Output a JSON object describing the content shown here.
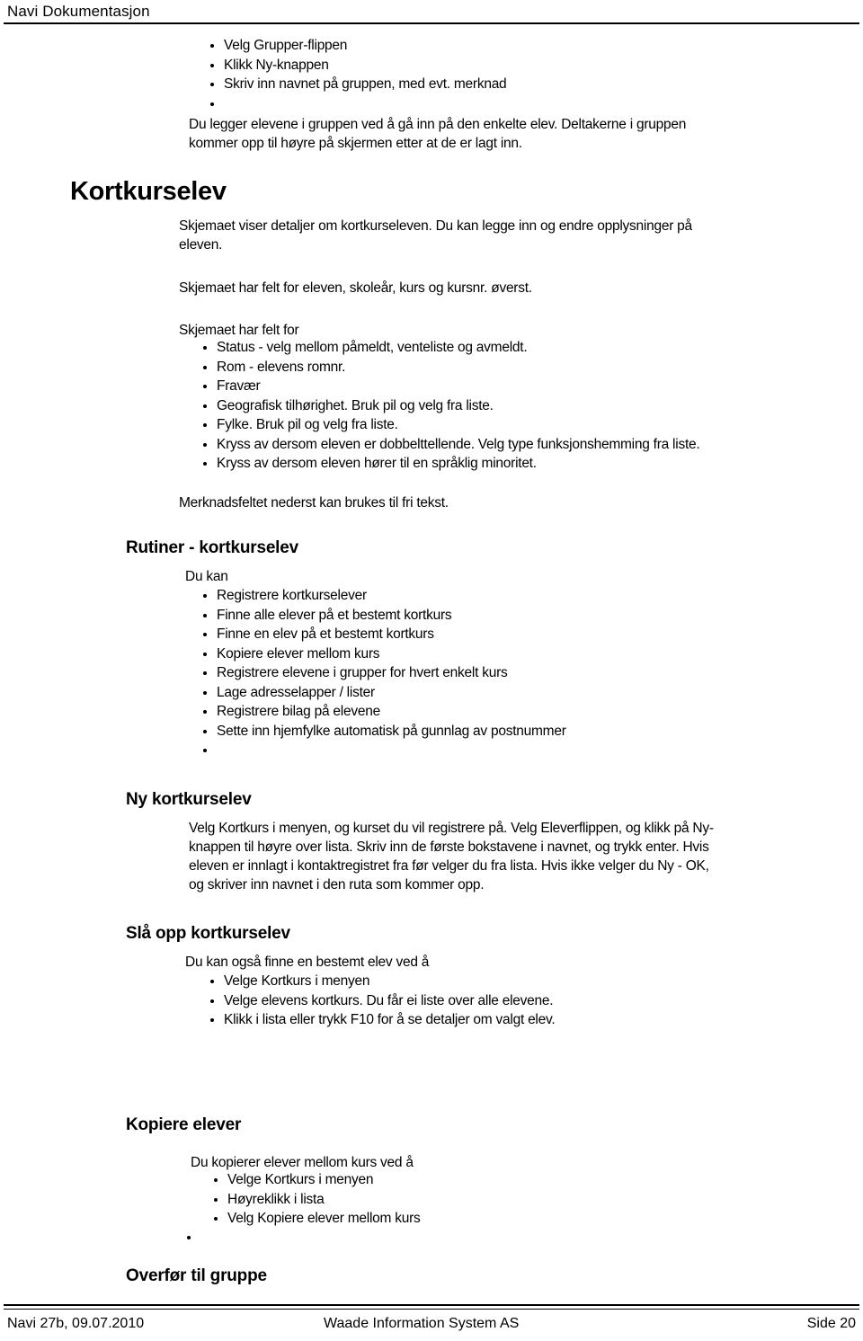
{
  "header": {
    "title": "Navi Dokumentasjon"
  },
  "sections": {
    "grupper_steps": {
      "bullets": [
        "Velg Grupper-flippen",
        "Klikk Ny-knappen",
        "Skriv inn navnet på gruppen, med evt. merknad",
        ""
      ],
      "paragraph_line1": "Du legger elevene i gruppen ved å gå inn på den enkelte elev. Deltakerne i gruppen",
      "paragraph_line2": "kommer opp til høyre på skjermen etter at de er lagt inn."
    },
    "kortkurselev": {
      "heading": "Kortkurselev",
      "intro_line1": "Skjemaet viser detaljer om kortkurseleven. Du kan legge inn og endre opplysninger på",
      "intro_line2": "eleven.",
      "fields_top": "Skjemaet har felt for eleven, skoleår, kurs og kursnr. øverst.",
      "fields_intro": "Skjemaet har felt for",
      "fields": [
        "Status - velg mellom påmeldt, venteliste og avmeldt.",
        "Rom - elevens romnr.",
        "Fravær",
        "Geografisk tilhørighet. Bruk pil og velg fra liste.",
        "Fylke. Bruk pil og velg fra liste.",
        "Kryss av dersom eleven er dobbelttellende. Velg type funksjonshemming fra liste.",
        "Kryss av dersom eleven hører til en språklig minoritet."
      ],
      "note": "Merknadsfeltet nederst kan brukes til fri tekst."
    },
    "rutiner": {
      "heading": "Rutiner - kortkurselev",
      "intro": "Du kan",
      "bullets": [
        "Registrere kortkurselever",
        "Finne alle elever på et bestemt kortkurs",
        "Finne en elev på et bestemt kortkurs",
        "Kopiere elever mellom kurs",
        "Registrere elevene i grupper for hvert enkelt kurs",
        "Lage adresselapper / lister",
        "Registrere bilag på elevene",
        "Sette inn hjemfylke automatisk på gunnlag av postnummer",
        ""
      ]
    },
    "ny_kortkurselev": {
      "heading": "Ny kortkurselev",
      "paragraph_lines": [
        "Velg Kortkurs i menyen, og kurset du vil registrere på. Velg Eleverflippen, og klikk på Ny-",
        "knappen til høyre over lista. Skriv inn de første bokstavene i navnet, og trykk enter. Hvis",
        "eleven er innlagt i kontaktregistret fra før velger du fra lista. Hvis ikke velger du Ny - OK,",
        "og skriver inn navnet i den ruta som kommer opp."
      ]
    },
    "sla_opp": {
      "heading": "Slå opp kortkurselev",
      "intro": "Du kan også finne en bestemt elev ved å",
      "bullets": [
        "Velge Kortkurs i menyen",
        "Velge elevens kortkurs. Du får ei liste over alle elevene.",
        "Klikk i lista eller trykk F10 for å se detaljer om valgt elev."
      ]
    },
    "kopiere_elever": {
      "heading": "Kopiere elever",
      "intro": "Du kopierer elever mellom kurs ved å",
      "bullets": [
        "Velge Kortkurs i menyen",
        "Høyreklikk i lista",
        "Velg Kopiere elever mellom kurs"
      ],
      "trailing_bullet": ""
    },
    "overfor_til_gruppe": {
      "heading": "Overfør til gruppe"
    }
  },
  "footer": {
    "left": "Navi 27b, 09.07.2010",
    "center": "Waade Information System AS",
    "right": "Side 20"
  }
}
